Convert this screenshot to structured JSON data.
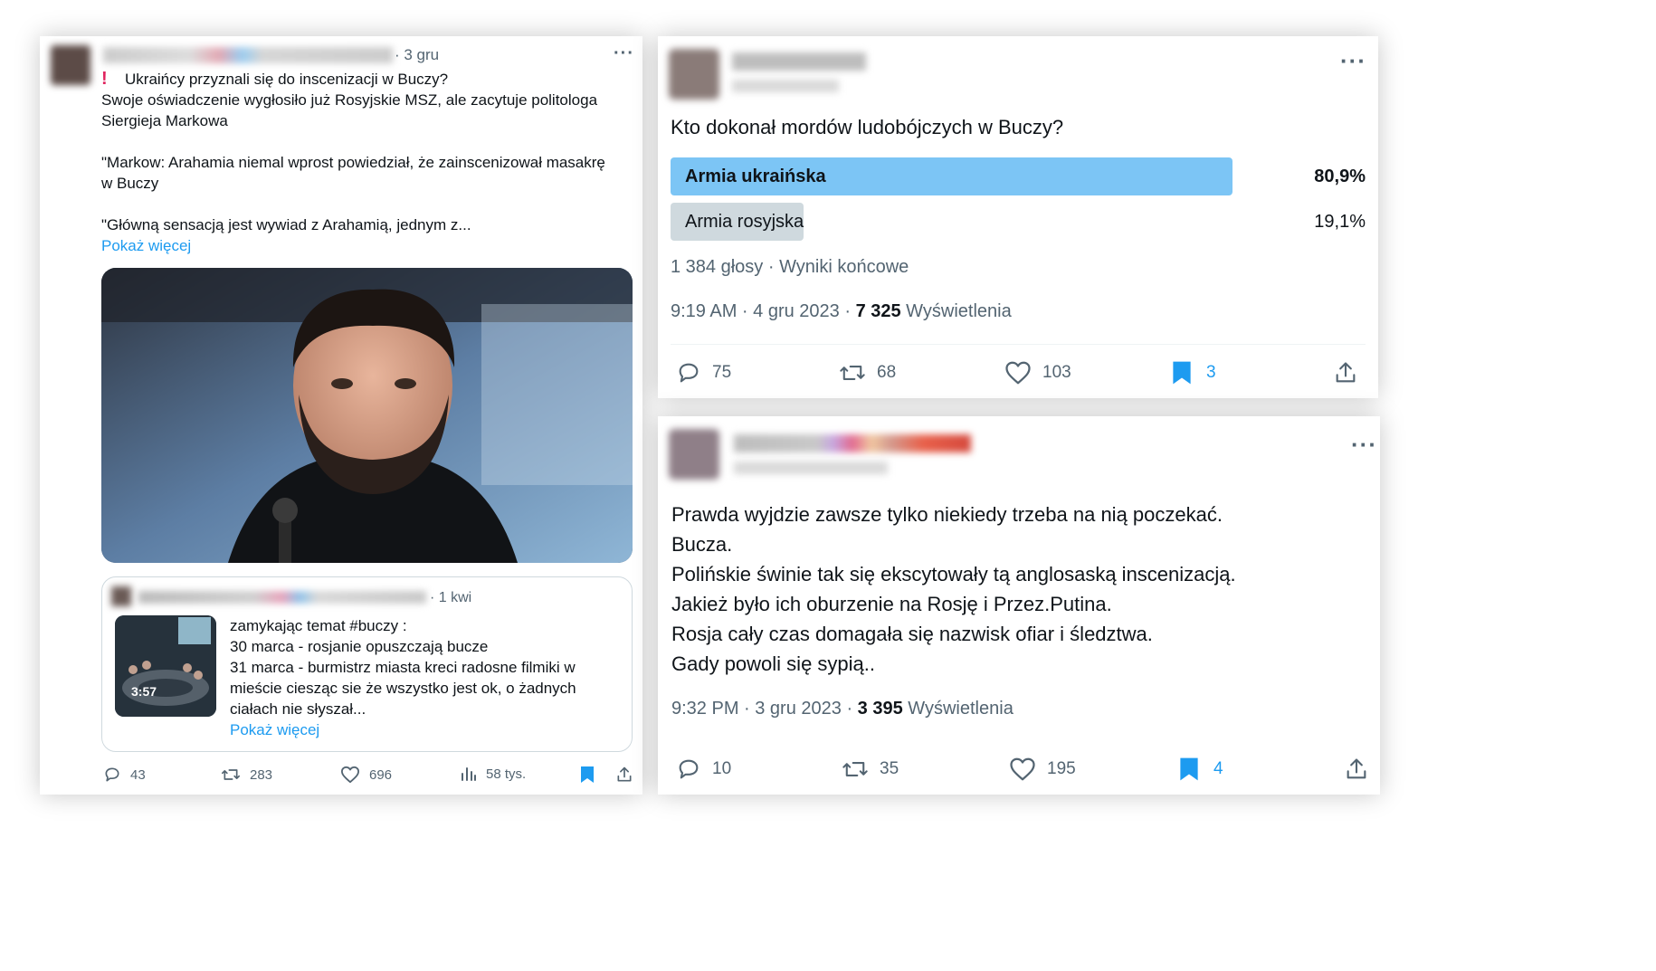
{
  "tweet1": {
    "time": "· 3 gru",
    "more": "···",
    "lines": [
      "Ukraińcy przyznali się do inscenizacji w Buczy?",
      "Swoje oświadczenie wygłosiło już Rosyjskie MSZ, ale zacytuje politologa",
      "Siergieja Markowa",
      "\"Markow: Arahamia niemal wprost powiedział, że zainscenizował masakrę",
      "w Buczy",
      "\"Główną sensacją jest wywiad z Arahamią, jednym z..."
    ],
    "show_more": "Pokaż więcej",
    "quote": {
      "time": "· 1 kwi",
      "video_duration": "3:57",
      "lines": [
        "zamykając temat #buczy :",
        "30 marca - rosjanie opuszczają bucze",
        "31 marca - burmistrz miasta kreci radosne filmiki w",
        "mieście ciesząc sie że wszystko jest ok, o żadnych",
        "ciałach nie słyszał..."
      ],
      "show_more": "Pokaż więcej"
    },
    "actions": {
      "replies": "43",
      "retweets": "283",
      "likes": "696",
      "views": "58 tys."
    }
  },
  "tweet2": {
    "more": "···",
    "question": "Kto dokonał mordów ludobójczych w Buczy?",
    "poll": [
      {
        "label": "Armia ukraińska",
        "percent": "80,9%",
        "fraction": 0.809,
        "winner": true
      },
      {
        "label": "Armia rosyjska",
        "percent": "19,1%",
        "fraction": 0.191,
        "winner": false
      }
    ],
    "poll_meta": "1 384 głosy · Wyniki końcowe",
    "timestamp": "9:19 AM · 4 gru 2023 · ",
    "views_count": "7 325",
    "views_label": " Wyświetlenia",
    "actions": {
      "replies": "75",
      "retweets": "68",
      "likes": "103",
      "bookmarks": "3"
    }
  },
  "tweet3": {
    "more": "···",
    "lines": [
      "Prawda wyjdzie zawsze tylko niekiedy trzeba na nią poczekać.",
      "Bucza.",
      "Polińskie świnie tak się ekscytowały tą anglosaską inscenizacją.",
      "Jakież było ich oburzenie na Rosję i Przez.Putina.",
      "Rosja cały czas domagała się nazwisk ofiar i śledztwa.",
      "Gady powoli się sypią.."
    ],
    "timestamp": "9:32 PM · 3 gru 2023 · ",
    "views_count": "3 395",
    "views_label": " Wyświetlenia",
    "actions": {
      "replies": "10",
      "retweets": "35",
      "likes": "195",
      "bookmarks": "4"
    }
  },
  "colors": {
    "accent": "#1d9bf0",
    "poll_winner": "#7cc5f5",
    "poll_other": "#cfd9de",
    "muted": "#536471",
    "alert": "#e0245e"
  },
  "icons": [
    "reply-icon",
    "retweet-icon",
    "like-icon",
    "views-icon",
    "bookmark-icon",
    "share-icon",
    "alert-icon",
    "more-icon"
  ]
}
